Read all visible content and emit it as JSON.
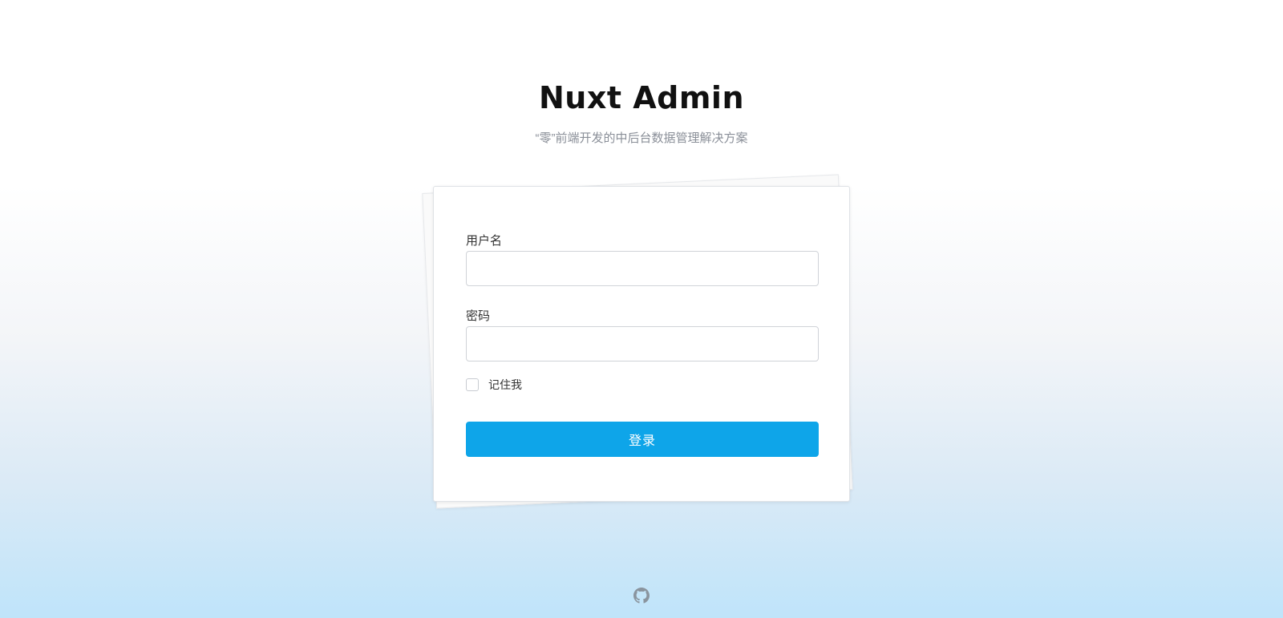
{
  "header": {
    "title": "Nuxt Admin",
    "subtitle": "“零”前端开发的中后台数据管理解决方案"
  },
  "form": {
    "username_label": "用户名",
    "username_value": "",
    "password_label": "密码",
    "password_value": "",
    "remember_label": "记住我",
    "remember_checked": false,
    "submit_label": "登录"
  },
  "footer": {
    "icon": "github-icon"
  },
  "colors": {
    "accent": "#0ea5e9",
    "title": "#111111",
    "subtitle": "#8a8f98"
  }
}
